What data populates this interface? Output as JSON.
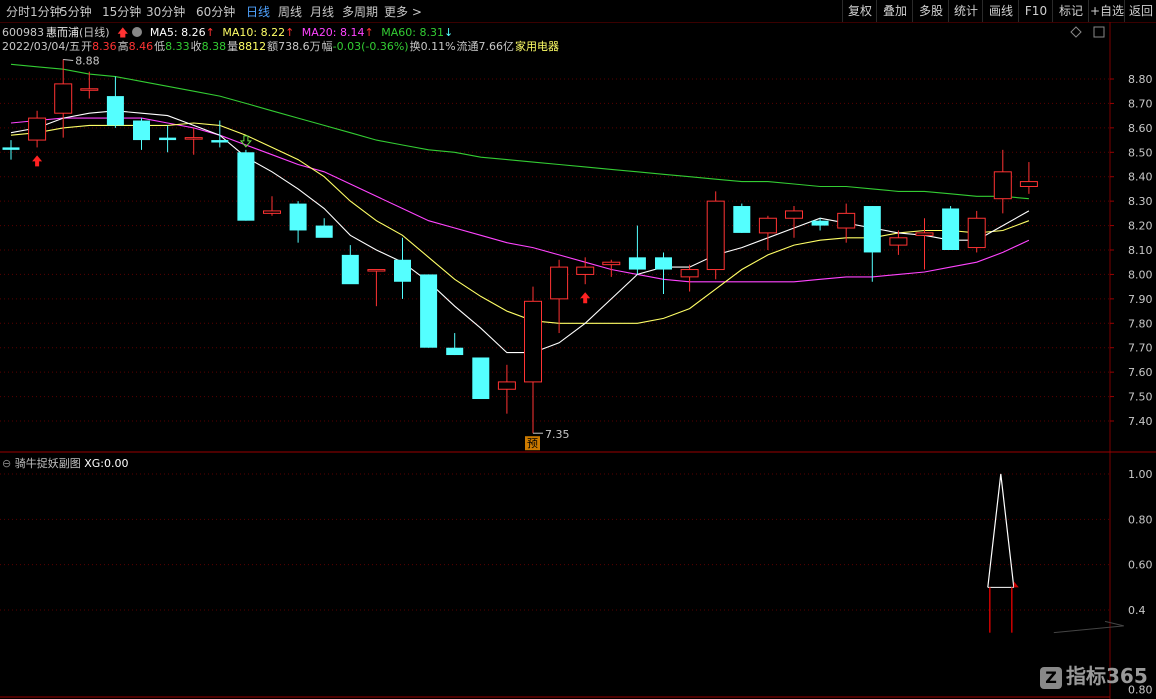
{
  "toolbar": {
    "left_items": [
      "分时",
      "1分钟",
      "5分钟",
      "15分钟",
      "30分钟",
      "60分钟",
      "日线",
      "周线",
      "月线",
      "多周期",
      "更多 >"
    ],
    "active": "日线",
    "right_items": [
      "复权",
      "叠加",
      "多股",
      "统计",
      "画线",
      "F10",
      "标记",
      "+自选",
      "返回"
    ]
  },
  "stock": {
    "code": "600983",
    "name": "惠而浦",
    "period": "(日线)",
    "ma5_label": "MA5:",
    "ma5_value": "8.26",
    "ma10_label": "MA10:",
    "ma10_value": "8.22",
    "ma20_label": "MA20:",
    "ma20_value": "8.14",
    "ma60_label": "MA60:",
    "ma60_value": "8.31",
    "date": "2022/03/04/五",
    "open_label": "开",
    "open": "8.36",
    "high_label": "高",
    "high": "8.46",
    "low_label": "低",
    "low": "8.33",
    "close_label": "收",
    "close": "8.38",
    "vol_label": "量",
    "vol": "8812",
    "amount_label": "额",
    "amount": "738.6万",
    "change_label": "幅",
    "change": "-0.03(-0.36%)",
    "turnover_label": "换",
    "turnover": "0.11%",
    "float_label": "流通",
    "float": "7.66亿",
    "industry": "家用电器"
  },
  "sub_panel": {
    "title": "骑牛捉妖副图",
    "xg_label": "XG:",
    "xg_value": "0.00"
  },
  "logo_text": "指标365",
  "logo_mark": "Z",
  "colors": {
    "up": "#ff3333",
    "down": "#54ffff",
    "ma5": "#ffffff",
    "ma10": "#ffff66",
    "ma20": "#ff44ff",
    "ma60": "#33cc33",
    "grid": "#5a0000",
    "axis_text": "#c8c8c8"
  },
  "chart_data": [
    {
      "type": "candlestick",
      "y_ticks": [
        8.8,
        8.7,
        8.6,
        8.5,
        8.4,
        8.3,
        8.2,
        8.1,
        8.0,
        7.9,
        7.8,
        7.7,
        7.6,
        7.5,
        7.4
      ],
      "y_tick_labels": [
        "8.80",
        "8.70",
        "8.60",
        "8.50",
        "8.40",
        "8.30",
        "8.20",
        "8.10",
        "8.00",
        "7.90",
        "7.80",
        "7.70",
        "7.60",
        "7.50",
        "7.40"
      ],
      "ylim": [
        7.32,
        8.93
      ],
      "high_annotation": "8.88",
      "low_annotation": "7.35",
      "marker_label": "预",
      "candles": [
        {
          "o": 8.52,
          "h": 8.55,
          "l": 8.47,
          "c": 8.51
        },
        {
          "o": 8.55,
          "h": 8.67,
          "l": 8.52,
          "c": 8.64
        },
        {
          "o": 8.66,
          "h": 8.88,
          "l": 8.56,
          "c": 8.78
        },
        {
          "o": 8.76,
          "h": 8.83,
          "l": 8.72,
          "c": 8.76
        },
        {
          "o": 8.73,
          "h": 8.81,
          "l": 8.6,
          "c": 8.61
        },
        {
          "o": 8.63,
          "h": 8.64,
          "l": 8.51,
          "c": 8.55
        },
        {
          "o": 8.56,
          "h": 8.61,
          "l": 8.5,
          "c": 8.55
        },
        {
          "o": 8.56,
          "h": 8.6,
          "l": 8.49,
          "c": 8.56
        },
        {
          "o": 8.55,
          "h": 8.63,
          "l": 8.52,
          "c": 8.54
        },
        {
          "o": 8.5,
          "h": 8.51,
          "l": 8.22,
          "c": 8.22
        },
        {
          "o": 8.25,
          "h": 8.32,
          "l": 8.24,
          "c": 8.26
        },
        {
          "o": 8.29,
          "h": 8.3,
          "l": 8.13,
          "c": 8.18
        },
        {
          "o": 8.2,
          "h": 8.23,
          "l": 8.16,
          "c": 8.15
        },
        {
          "o": 8.08,
          "h": 8.12,
          "l": 7.97,
          "c": 7.96
        },
        {
          "o": 8.02,
          "h": 8.02,
          "l": 7.87,
          "c": 8.02
        },
        {
          "o": 8.06,
          "h": 8.15,
          "l": 7.9,
          "c": 7.97
        },
        {
          "o": 8.0,
          "h": 8.0,
          "l": 7.7,
          "c": 7.7
        },
        {
          "o": 7.7,
          "h": 7.76,
          "l": 7.67,
          "c": 7.67
        },
        {
          "o": 7.66,
          "h": 7.66,
          "l": 7.49,
          "c": 7.49
        },
        {
          "o": 7.53,
          "h": 7.63,
          "l": 7.43,
          "c": 7.56
        },
        {
          "o": 7.56,
          "h": 7.95,
          "l": 7.35,
          "c": 7.89
        },
        {
          "o": 7.9,
          "h": 8.06,
          "l": 7.76,
          "c": 8.03
        },
        {
          "o": 8.0,
          "h": 8.07,
          "l": 7.96,
          "c": 8.03
        },
        {
          "o": 8.04,
          "h": 8.06,
          "l": 7.99,
          "c": 8.05
        },
        {
          "o": 8.07,
          "h": 8.2,
          "l": 8.0,
          "c": 8.02
        },
        {
          "o": 8.07,
          "h": 8.09,
          "l": 7.92,
          "c": 8.02
        },
        {
          "o": 7.99,
          "h": 8.04,
          "l": 7.93,
          "c": 8.02
        },
        {
          "o": 8.02,
          "h": 8.34,
          "l": 7.98,
          "c": 8.3
        },
        {
          "o": 8.28,
          "h": 8.29,
          "l": 8.17,
          "c": 8.17
        },
        {
          "o": 8.17,
          "h": 8.24,
          "l": 8.1,
          "c": 8.23
        },
        {
          "o": 8.23,
          "h": 8.28,
          "l": 8.15,
          "c": 8.26
        },
        {
          "o": 8.22,
          "h": 8.23,
          "l": 8.18,
          "c": 8.2
        },
        {
          "o": 8.19,
          "h": 8.29,
          "l": 8.13,
          "c": 8.25
        },
        {
          "o": 8.28,
          "h": 8.28,
          "l": 7.97,
          "c": 8.09
        },
        {
          "o": 8.12,
          "h": 8.18,
          "l": 8.08,
          "c": 8.15
        },
        {
          "o": 8.16,
          "h": 8.23,
          "l": 8.02,
          "c": 8.17
        },
        {
          "o": 8.27,
          "h": 8.28,
          "l": 8.1,
          "c": 8.1
        },
        {
          "o": 8.11,
          "h": 8.26,
          "l": 8.09,
          "c": 8.23
        },
        {
          "o": 8.31,
          "h": 8.51,
          "l": 8.25,
          "c": 8.42
        },
        {
          "o": 8.36,
          "h": 8.46,
          "l": 8.33,
          "c": 8.38
        }
      ],
      "ma5": [
        8.58,
        8.6,
        8.64,
        8.66,
        8.67,
        8.66,
        8.65,
        8.61,
        8.57,
        8.48,
        8.42,
        8.35,
        8.27,
        8.16,
        8.1,
        8.05,
        7.97,
        7.87,
        7.78,
        7.68,
        7.68,
        7.72,
        7.8,
        7.9,
        8.0,
        8.03,
        8.03,
        8.08,
        8.11,
        8.15,
        8.19,
        8.23,
        8.21,
        8.19,
        8.17,
        8.16,
        8.14,
        8.14,
        8.2,
        8.26
      ],
      "ma10": [
        8.57,
        8.58,
        8.6,
        8.61,
        8.61,
        8.61,
        8.61,
        8.62,
        8.61,
        8.57,
        8.52,
        8.47,
        8.4,
        8.3,
        8.22,
        8.16,
        8.07,
        7.98,
        7.91,
        7.85,
        7.81,
        7.8,
        7.8,
        7.8,
        7.8,
        7.82,
        7.86,
        7.94,
        8.02,
        8.08,
        8.12,
        8.14,
        8.15,
        8.15,
        8.17,
        8.18,
        8.18,
        8.17,
        8.18,
        8.22
      ],
      "ma20": [
        8.62,
        8.63,
        8.64,
        8.64,
        8.64,
        8.64,
        8.62,
        8.6,
        8.57,
        8.53,
        8.49,
        8.45,
        8.42,
        8.37,
        8.32,
        8.27,
        8.22,
        8.19,
        8.16,
        8.13,
        8.11,
        8.08,
        8.05,
        8.02,
        8.0,
        7.98,
        7.97,
        7.97,
        7.97,
        7.97,
        7.97,
        7.98,
        7.99,
        7.99,
        8.0,
        8.01,
        8.03,
        8.05,
        8.09,
        8.14
      ],
      "ma60": [
        8.86,
        8.85,
        8.84,
        8.82,
        8.81,
        8.79,
        8.77,
        8.75,
        8.73,
        8.7,
        8.67,
        8.64,
        8.61,
        8.58,
        8.55,
        8.53,
        8.51,
        8.5,
        8.48,
        8.47,
        8.46,
        8.45,
        8.44,
        8.43,
        8.42,
        8.41,
        8.4,
        8.39,
        8.38,
        8.38,
        8.37,
        8.36,
        8.36,
        8.35,
        8.34,
        8.34,
        8.33,
        8.32,
        8.32,
        8.31
      ],
      "buy_arrows": [
        1,
        22
      ],
      "sell_arrows": [
        9
      ]
    },
    {
      "type": "line",
      "y_ticks": [
        1.0,
        0.8,
        0.6,
        0.4
      ],
      "y_tick_labels": [
        "1.00",
        "0.80",
        "0.60",
        "0.4"
      ],
      "ylim": [
        0.22,
        1.06
      ],
      "xg": [
        0,
        0,
        0,
        0,
        0,
        0,
        0,
        0,
        0,
        0,
        0,
        0,
        0,
        0,
        0,
        0,
        0,
        0,
        0,
        0,
        0,
        0,
        0,
        0,
        0,
        0,
        0,
        0,
        0,
        0,
        0,
        0,
        0,
        0,
        0,
        0,
        0,
        0.5,
        1.0,
        0.5
      ]
    }
  ]
}
